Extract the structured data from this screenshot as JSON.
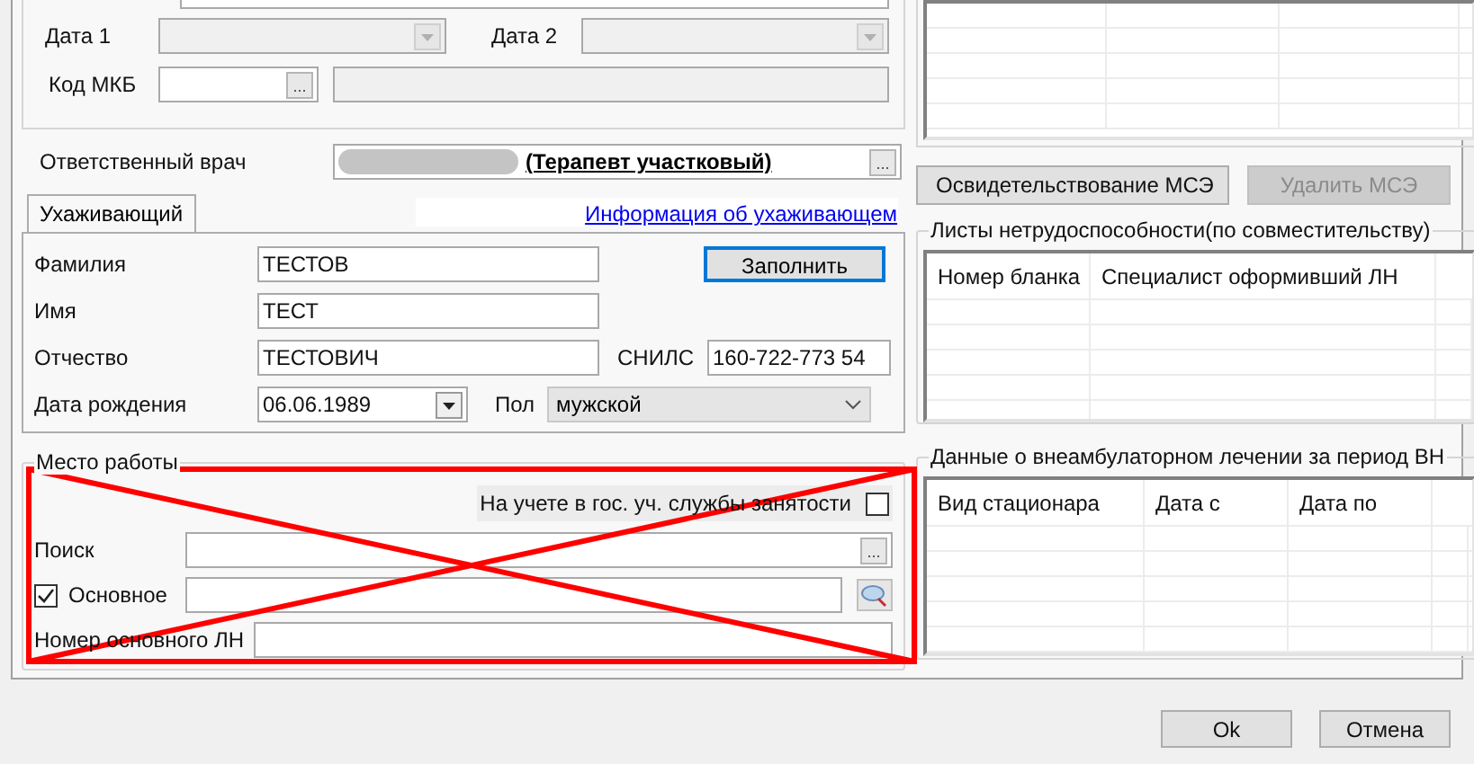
{
  "diagnosis": {
    "date1": {
      "label": "Дата 1",
      "disabled": true
    },
    "date2": {
      "label": "Дата 2",
      "disabled": true
    },
    "mkb": {
      "label": "Код МКБ",
      "button": "..."
    }
  },
  "doctor": {
    "label": "Ответственный врач",
    "value": "(Терапевт участковый)",
    "button": "..."
  },
  "tabs": [
    {
      "label": "Ухаживающий",
      "selected": true
    }
  ],
  "caregiver_link": "Информация об ухаживающем",
  "caregiver": {
    "surname": {
      "label": "Фамилия",
      "value": "ТЕСТОВ"
    },
    "name": {
      "label": "Имя",
      "value": "ТЕСТ"
    },
    "patronymic": {
      "label": "Отчество",
      "value": "ТЕСТОВИЧ"
    },
    "snils": {
      "label": "СНИЛС",
      "value": "160-722-773 54"
    },
    "birth_date": {
      "label": "Дата рождения",
      "value": "06.06.1989"
    },
    "sex": {
      "label": "Пол",
      "value": "мужской"
    },
    "fill_button": "Заполнить"
  },
  "workplace": {
    "title": "Место работы",
    "crossed_out": true,
    "employment_service": {
      "label": "На учете в гос. уч. службы занятости",
      "checked": false
    },
    "search": {
      "label": "Поиск",
      "button": "..."
    },
    "main": {
      "label": "Основное",
      "checked": true
    },
    "main_sheet_number": {
      "label": "Номер основного ЛН"
    }
  },
  "mse_buttons": [
    {
      "label": "Освидетельствование МСЭ",
      "disabled": false
    },
    {
      "label": "Удалить МСЭ",
      "disabled": true
    }
  ],
  "part_time_sheets": {
    "title": "Листы нетрудоспособности(по совместительству)",
    "columns": [
      "Номер бланка",
      "Специалист оформивший ЛН"
    ]
  },
  "inpatient": {
    "title": "Данные о внеамбулаторном лечении за период ВН",
    "columns": [
      "Вид стационара",
      "Дата с",
      "Дата по"
    ]
  },
  "buttons": [
    "Ok",
    "Отмена"
  ]
}
